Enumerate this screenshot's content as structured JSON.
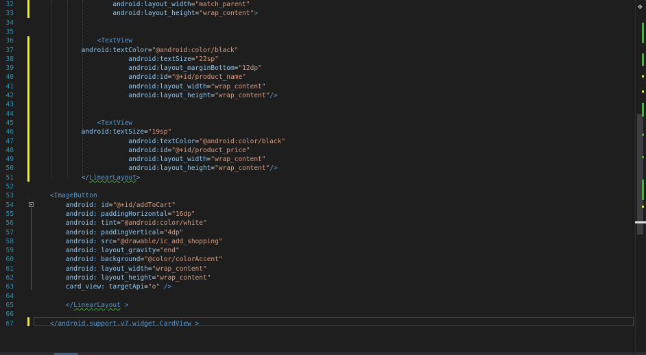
{
  "editor": {
    "lines": [
      {
        "num": "32",
        "segs": [
          [
            "                    ",
            ""
          ],
          [
            "android:layout_width",
            "a"
          ],
          [
            "=",
            "p"
          ],
          [
            "\"match_parent\"",
            "s"
          ]
        ]
      },
      {
        "num": "33",
        "segs": [
          [
            "                    ",
            ""
          ],
          [
            "android:layout_height",
            "a"
          ],
          [
            "=",
            "p"
          ],
          [
            "\"wrap_content\"",
            "s"
          ],
          [
            ">",
            "t"
          ]
        ]
      },
      {
        "num": "34",
        "segs": []
      },
      {
        "num": "35",
        "segs": []
      },
      {
        "num": "36",
        "segs": [
          [
            "                ",
            ""
          ],
          [
            "<",
            "t"
          ],
          [
            "TextView",
            "t"
          ]
        ]
      },
      {
        "num": "37",
        "segs": [
          [
            "            ",
            ""
          ],
          [
            "android:textColor",
            "a"
          ],
          [
            "=",
            "p"
          ],
          [
            "\"@android:color/black\"",
            "s"
          ]
        ]
      },
      {
        "num": "38",
        "segs": [
          [
            "                        ",
            ""
          ],
          [
            "android:textSize",
            "a"
          ],
          [
            "=",
            "p"
          ],
          [
            "\"22sp\"",
            "s"
          ]
        ]
      },
      {
        "num": "39",
        "segs": [
          [
            "                        ",
            ""
          ],
          [
            "android:layout_marginBottom",
            "a"
          ],
          [
            "=",
            "p"
          ],
          [
            "\"12dp\"",
            "s"
          ]
        ]
      },
      {
        "num": "40",
        "segs": [
          [
            "                        ",
            ""
          ],
          [
            "android:id",
            "a"
          ],
          [
            "=",
            "p"
          ],
          [
            "\"@+id/product_name\"",
            "s"
          ]
        ]
      },
      {
        "num": "41",
        "segs": [
          [
            "                        ",
            ""
          ],
          [
            "android:layout_width",
            "a"
          ],
          [
            "=",
            "p"
          ],
          [
            "\"wrap_content\"",
            "s"
          ]
        ]
      },
      {
        "num": "42",
        "segs": [
          [
            "                        ",
            ""
          ],
          [
            "android:layout_height",
            "a"
          ],
          [
            "=",
            "p"
          ],
          [
            "\"wrap_content\"",
            "s"
          ],
          [
            "/>",
            "t"
          ]
        ]
      },
      {
        "num": "43",
        "segs": []
      },
      {
        "num": "44",
        "segs": []
      },
      {
        "num": "45",
        "segs": [
          [
            "                ",
            ""
          ],
          [
            "<",
            "t"
          ],
          [
            "TextView",
            "t"
          ]
        ]
      },
      {
        "num": "46",
        "segs": [
          [
            "            ",
            ""
          ],
          [
            "android:textSize",
            "a"
          ],
          [
            "=",
            "p"
          ],
          [
            "\"19sp\"",
            "s"
          ]
        ]
      },
      {
        "num": "47",
        "segs": [
          [
            "                        ",
            ""
          ],
          [
            "android:textColor",
            "a"
          ],
          [
            "=",
            "p"
          ],
          [
            "\"@android:color/black\"",
            "s"
          ]
        ]
      },
      {
        "num": "48",
        "segs": [
          [
            "                        ",
            ""
          ],
          [
            "android:id",
            "a"
          ],
          [
            "=",
            "p"
          ],
          [
            "\"@+id/product_price\"",
            "s"
          ]
        ]
      },
      {
        "num": "49",
        "segs": [
          [
            "                        ",
            ""
          ],
          [
            "android:layout_width",
            "a"
          ],
          [
            "=",
            "p"
          ],
          [
            "\"wrap_content\"",
            "s"
          ]
        ]
      },
      {
        "num": "50",
        "segs": [
          [
            "                        ",
            ""
          ],
          [
            "android:layout_height",
            "a"
          ],
          [
            "=",
            "p"
          ],
          [
            "\"wrap_content\"",
            "s"
          ],
          [
            "/>",
            "t"
          ]
        ]
      },
      {
        "num": "51",
        "segs": [
          [
            "            ",
            ""
          ],
          [
            "</",
            "t"
          ],
          [
            "LinearLayout",
            "tu"
          ],
          [
            ">",
            "t"
          ]
        ]
      },
      {
        "num": "52",
        "segs": []
      },
      {
        "num": "53",
        "segs": [
          [
            "    ",
            ""
          ],
          [
            "<",
            "t"
          ],
          [
            "ImageButton",
            "t"
          ]
        ]
      },
      {
        "num": "54",
        "segs": [
          [
            "        ",
            ""
          ],
          [
            "android:",
            "a"
          ],
          [
            " id",
            "a"
          ],
          [
            "=",
            "p"
          ],
          [
            "\"@+id/addToCart\"",
            "s"
          ]
        ]
      },
      {
        "num": "55",
        "segs": [
          [
            "        ",
            ""
          ],
          [
            "android:",
            "a"
          ],
          [
            " paddingHorizontal",
            "a"
          ],
          [
            "=",
            "p"
          ],
          [
            "\"16dp\"",
            "s"
          ]
        ]
      },
      {
        "num": "56",
        "segs": [
          [
            "        ",
            ""
          ],
          [
            "android:",
            "a"
          ],
          [
            " tint",
            "a"
          ],
          [
            "=",
            "p"
          ],
          [
            "\"@android:color/white\"",
            "s"
          ]
        ]
      },
      {
        "num": "57",
        "segs": [
          [
            "        ",
            ""
          ],
          [
            "android:",
            "a"
          ],
          [
            " paddingVertical",
            "a"
          ],
          [
            "=",
            "p"
          ],
          [
            "\"4dp\"",
            "s"
          ]
        ]
      },
      {
        "num": "58",
        "segs": [
          [
            "        ",
            ""
          ],
          [
            "android:",
            "a"
          ],
          [
            " src",
            "a"
          ],
          [
            "=",
            "p"
          ],
          [
            "\"@drawable/ic_add_shopping\"",
            "s"
          ]
        ]
      },
      {
        "num": "59",
        "segs": [
          [
            "        ",
            ""
          ],
          [
            "android:",
            "a"
          ],
          [
            " layout_gravity",
            "a"
          ],
          [
            "=",
            "p"
          ],
          [
            "\"end\"",
            "s"
          ]
        ]
      },
      {
        "num": "60",
        "segs": [
          [
            "        ",
            ""
          ],
          [
            "android:",
            "a"
          ],
          [
            " background",
            "a"
          ],
          [
            "=",
            "p"
          ],
          [
            "\"@color/colorAccent\"",
            "s"
          ]
        ]
      },
      {
        "num": "61",
        "segs": [
          [
            "        ",
            ""
          ],
          [
            "android:",
            "a"
          ],
          [
            " layout_width",
            "a"
          ],
          [
            "=",
            "p"
          ],
          [
            "\"wrap_content\"",
            "s"
          ]
        ]
      },
      {
        "num": "62",
        "segs": [
          [
            "        ",
            ""
          ],
          [
            "android:",
            "a"
          ],
          [
            " layout_height",
            "a"
          ],
          [
            "=",
            "p"
          ],
          [
            "\"wrap_content\"",
            "s"
          ]
        ]
      },
      {
        "num": "63",
        "segs": [
          [
            "        ",
            ""
          ],
          [
            "card_view:",
            "a"
          ],
          [
            " targetApi",
            "a"
          ],
          [
            "=",
            "p"
          ],
          [
            "\"o\"",
            "s"
          ],
          [
            " />",
            "t"
          ]
        ]
      },
      {
        "num": "64",
        "segs": []
      },
      {
        "num": "65",
        "segs": [
          [
            "        ",
            ""
          ],
          [
            "</",
            "t"
          ],
          [
            "LinearLayout",
            "tu"
          ],
          [
            " >",
            "t"
          ]
        ]
      },
      {
        "num": "66",
        "segs": []
      },
      {
        "num": "67",
        "segs": [
          [
            "    ",
            ""
          ],
          [
            "</",
            "t"
          ],
          [
            "android.support.v7.widget.CardView",
            "t"
          ],
          [
            " >",
            "t"
          ]
        ]
      }
    ]
  },
  "scrollbar": {
    "split_icon": "✥",
    "split_icon_name": "split-window-icon"
  }
}
